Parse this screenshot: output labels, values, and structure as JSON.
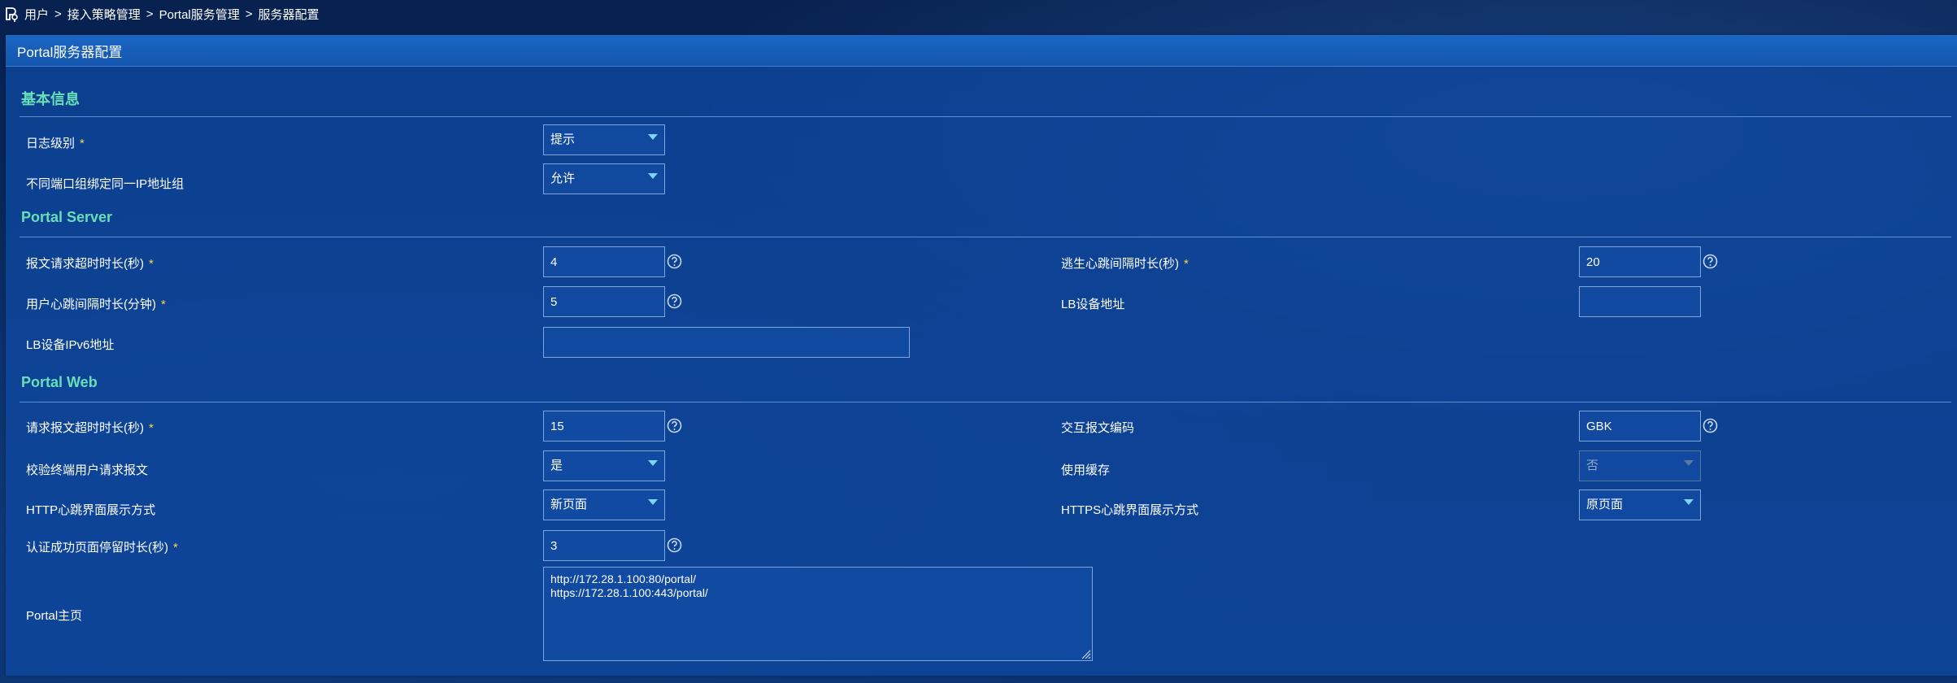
{
  "breadcrumb": [
    "用户",
    "接入策略管理",
    "Portal服务管理",
    "服务器配置"
  ],
  "breadcrumb_separator": ">",
  "panel": {
    "title": "Portal服务器配置"
  },
  "required_mark": "*",
  "sections": {
    "basic": {
      "title": "基本信息",
      "log_level": {
        "label": "日志级别",
        "value": "提示"
      },
      "same_ip_group": {
        "label": "不同端口组绑定同一IP地址组",
        "value": "允许"
      }
    },
    "server": {
      "title": "Portal Server",
      "request_timeout": {
        "label": "报文请求超时时长(秒)",
        "value": "4"
      },
      "escape_heartbeat": {
        "label": "逃生心跳间隔时长(秒)",
        "value": "20"
      },
      "user_heartbeat": {
        "label": "用户心跳间隔时长(分钟)",
        "value": "5"
      },
      "lb_address": {
        "label": "LB设备地址",
        "value": ""
      },
      "lb_ipv6": {
        "label": "LB设备IPv6地址",
        "value": ""
      }
    },
    "web": {
      "title": "Portal Web",
      "request_timeout": {
        "label": "请求报文超时时长(秒)",
        "value": "15"
      },
      "encoding": {
        "label": "交互报文编码",
        "value": "GBK"
      },
      "verify_request": {
        "label": "校验终端用户请求报文",
        "value": "是"
      },
      "use_cache": {
        "label": "使用缓存",
        "value": "否"
      },
      "http_heartbeat": {
        "label": "HTTP心跳界面展示方式",
        "value": "新页面"
      },
      "https_heartbeat": {
        "label": "HTTPS心跳界面展示方式",
        "value": "原页面"
      },
      "success_stay": {
        "label": "认证成功页面停留时长(秒)",
        "value": "3"
      },
      "homepage": {
        "label": "Portal主页",
        "value": "http://172.28.1.100:80/portal/\nhttps://172.28.1.100:443/portal/"
      }
    }
  },
  "icons": {
    "breadcrumb": "user-location-icon",
    "help": "question-circle-icon",
    "caret": "caret-down-icon"
  },
  "colors": {
    "section_title": "#66dfb8",
    "required": "#ffd34a",
    "header": "#1a66c4",
    "panel": "#0e48a0"
  }
}
